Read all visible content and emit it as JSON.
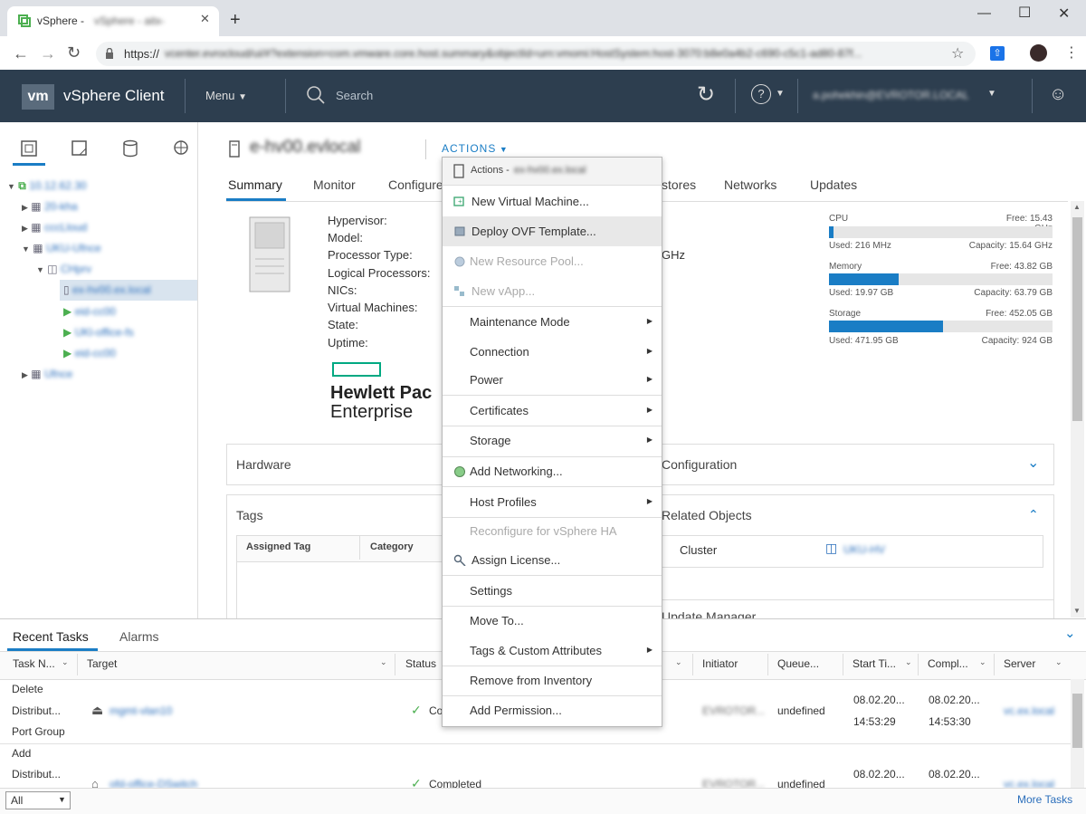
{
  "browser": {
    "tab_title": "vSphere - ",
    "tab_title_blurred": "vSphere - aitx-hv03.ex.local - Summary",
    "new_tab": "+",
    "url_prefix": "https://",
    "url_rest": "vcenter.evrocloud/ui/#?extension=com.vmware.core.host.summary&objectId=urn:vmomi:HostSystem:host-3070:b8e0a4b2-c690-c5c1-ad80-87f...",
    "window_controls": [
      "–",
      "☐",
      "✕"
    ]
  },
  "header": {
    "logo": "vm",
    "app_title": "vSphere Client",
    "menu_label": "Menu",
    "search_placeholder": "Search",
    "user": "a.pohekhin@EVROTOR.LOCAL",
    "help": "?"
  },
  "nav": {
    "tree": [
      {
        "label": "10.12.62.30"
      },
      {
        "label": "20-kha"
      },
      {
        "label": "cccLloud"
      },
      {
        "label": "UKU-Ufnce"
      },
      {
        "label": "CHprv"
      },
      {
        "label": "ex-hv00.ex.local"
      },
      {
        "label": "eid-cc00"
      },
      {
        "label": "UKl-office-fs"
      },
      {
        "label": "eid-cc00"
      },
      {
        "label": "Ufnce"
      }
    ]
  },
  "host": {
    "name": "e-hv00.evlocal",
    "actions_label": "ACTIONS"
  },
  "tabs": [
    "Summary",
    "Monitor",
    "Configure",
    "stores",
    "Networks",
    "Updates"
  ],
  "summary": {
    "labels": [
      "Hypervisor:",
      "Model:",
      "Processor Type:",
      "Logical Processors:",
      "NICs:",
      "Virtual Machines:",
      "State:",
      "Uptime:"
    ],
    "ghz_fragment": "GHz",
    "vendor_line1": "Hewlett Pac",
    "vendor_line2": "Enterprise"
  },
  "resources": [
    {
      "name": "CPU",
      "free": "Free: 15.43 GHz",
      "used": "Used: 216 MHz",
      "capacity": "Capacity: 15.64 GHz",
      "used_fraction": 0.014
    },
    {
      "name": "Memory",
      "free": "Free: 43.82 GB",
      "used": "Used: 19.97 GB",
      "capacity": "Capacity: 63.79 GB",
      "used_fraction": 0.31
    },
    {
      "name": "Storage",
      "free": "Free: 452.05 GB",
      "used": "Used: 471.95 GB",
      "capacity": "Capacity: 924 GB",
      "used_fraction": 0.51
    }
  ],
  "panels": {
    "hardware": "Hardware",
    "configuration": "Configuration",
    "tags": "Tags",
    "related": "Related Objects",
    "tag_col1": "Assigned Tag",
    "tag_col2": "Category",
    "cluster_label": "Cluster",
    "cluster_value": "UKU-HV",
    "update_manager": "Update Manager"
  },
  "actions_menu": {
    "header": "Actions - ",
    "header_name": "ex-hv00.ex.local",
    "items": [
      {
        "label": "New Virtual Machine...",
        "disabled": false,
        "submenu": false
      },
      {
        "label": "Deploy OVF Template...",
        "disabled": false,
        "submenu": false
      },
      {
        "label": "New Resource Pool...",
        "disabled": true,
        "submenu": false
      },
      {
        "label": "New vApp...",
        "disabled": true,
        "submenu": false
      },
      {
        "label": "Maintenance Mode",
        "disabled": false,
        "submenu": true
      },
      {
        "label": "Connection",
        "disabled": false,
        "submenu": true
      },
      {
        "label": "Power",
        "disabled": false,
        "submenu": true
      },
      {
        "label": "Certificates",
        "disabled": false,
        "submenu": true
      },
      {
        "label": "Storage",
        "disabled": false,
        "submenu": true
      },
      {
        "label": "Add Networking...",
        "disabled": false,
        "submenu": false
      },
      {
        "label": "Host Profiles",
        "disabled": false,
        "submenu": true
      },
      {
        "label": "Reconfigure for vSphere HA",
        "disabled": true,
        "submenu": false
      },
      {
        "label": "Assign License...",
        "disabled": false,
        "submenu": false
      },
      {
        "label": "Settings",
        "disabled": false,
        "submenu": false
      },
      {
        "label": "Move To...",
        "disabled": false,
        "submenu": false
      },
      {
        "label": "Tags & Custom Attributes",
        "disabled": false,
        "submenu": true
      },
      {
        "label": "Remove from Inventory",
        "disabled": false,
        "submenu": false
      },
      {
        "label": "Add Permission...",
        "disabled": false,
        "submenu": false
      }
    ]
  },
  "tasks": {
    "tab_recent": "Recent Tasks",
    "tab_alarms": "Alarms",
    "columns": [
      "Task N...",
      "Target",
      "Status",
      "Initiator",
      "Queue...",
      "Start Ti...",
      "Compl...",
      "Server"
    ],
    "rows": [
      {
        "task_lines": [
          "Delete",
          "Distribut...",
          "Port Group"
        ],
        "target": "mgmt-vlan10",
        "status": "Co",
        "initiator": "EVROTOR...",
        "queued": "undefined",
        "start": [
          "08.02.20...",
          "14:53:29"
        ],
        "complete": [
          "08.02.20...",
          "14:53:30"
        ],
        "server": "vc.ex.local"
      },
      {
        "task_lines": [
          "Add",
          "Distribut..."
        ],
        "target": "ofd-office-DSwitch",
        "status": "Completed",
        "initiator": "EVROTOR...",
        "queued": "undefined",
        "start": [
          "08.02.20..."
        ],
        "complete": [
          "08.02.20..."
        ],
        "server": "vc.ex.local"
      }
    ],
    "filter_value": "All",
    "more_tasks": "More Tasks"
  },
  "colors": {
    "header_bg": "#2d3e4f",
    "accent": "#1a7dc5",
    "link": "#2a6ebb",
    "hpe_green": "#01a982"
  }
}
